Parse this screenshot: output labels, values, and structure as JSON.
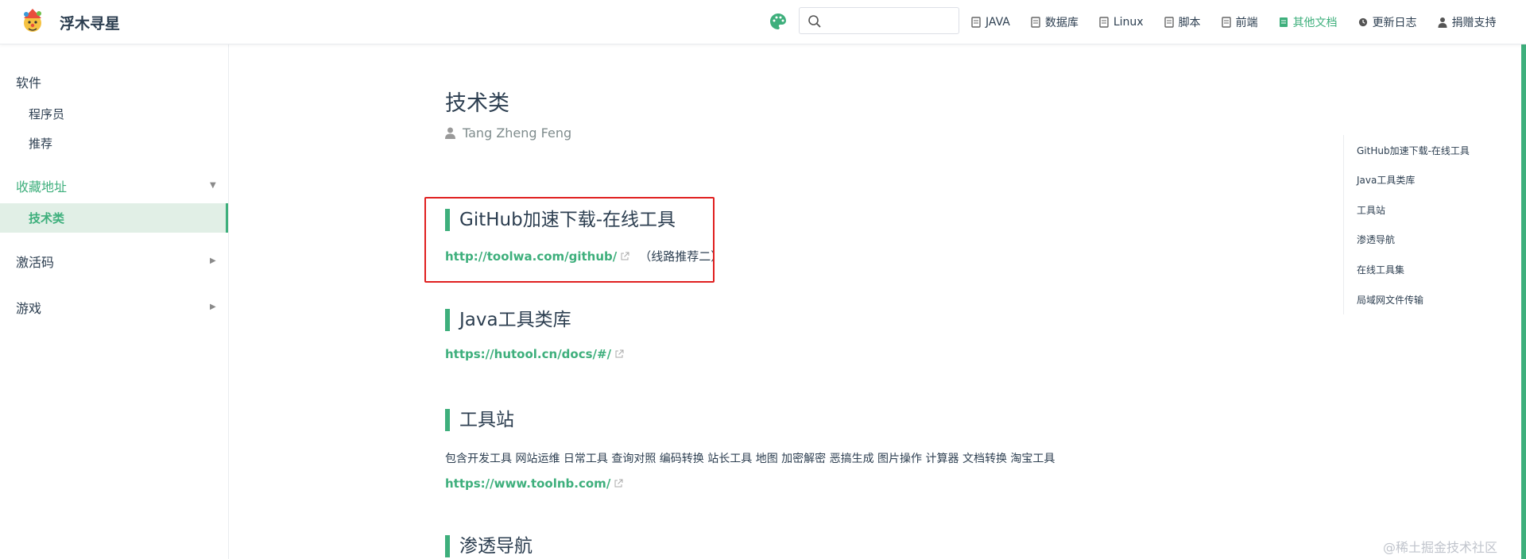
{
  "navbar": {
    "site_name": "浮木寻星",
    "search": {
      "placeholder": "",
      "value": ""
    },
    "links": [
      {
        "label": "JAVA",
        "icon": "doc-icon",
        "active": false
      },
      {
        "label": "数据库",
        "icon": "doc-icon",
        "active": false
      },
      {
        "label": "Linux",
        "icon": "doc-icon",
        "active": false
      },
      {
        "label": "脚本",
        "icon": "doc-icon",
        "active": false
      },
      {
        "label": "前端",
        "icon": "doc-icon",
        "active": false
      },
      {
        "label": "其他文档",
        "icon": "doc-icon",
        "active": true
      },
      {
        "label": "更新日志",
        "icon": "clock-icon",
        "active": false
      },
      {
        "label": "捐赠支持",
        "icon": "user-icon",
        "active": false
      }
    ]
  },
  "sidebar": {
    "groups": [
      {
        "heading": "软件",
        "items": [
          "程序员",
          "推荐"
        ]
      },
      {
        "heading": "收藏地址",
        "items": [
          "技术类"
        ],
        "active": true
      },
      {
        "heading": "激活码",
        "items": []
      },
      {
        "heading": "游戏",
        "items": []
      }
    ]
  },
  "main": {
    "title": "技术类",
    "author": "Tang Zheng Feng",
    "sections": [
      {
        "heading": "GitHub加速下载-在线工具",
        "link": "http://toolwa.com/github/",
        "note": "（线路推荐二）"
      },
      {
        "heading": "Java工具类库",
        "link": "https://hutool.cn/docs/#/"
      },
      {
        "heading": "工具站",
        "desc": "包含开发工具 网站运维 日常工具 查询对照 编码转换 站长工具 地图 加密解密 恶搞生成 图片操作 计算器 文档转换 淘宝工具",
        "link": "https://www.toolnb.com/"
      },
      {
        "heading": "渗透导航"
      }
    ]
  },
  "toc": [
    "GitHub加速下载-在线工具",
    "Java工具类库",
    "工具站",
    "渗透导航",
    "在线工具集",
    "局域网文件传输"
  ],
  "watermark": "@稀土掘金技术社区",
  "colors": {
    "accent": "#3eaf7c",
    "highlight": "#e02020"
  }
}
